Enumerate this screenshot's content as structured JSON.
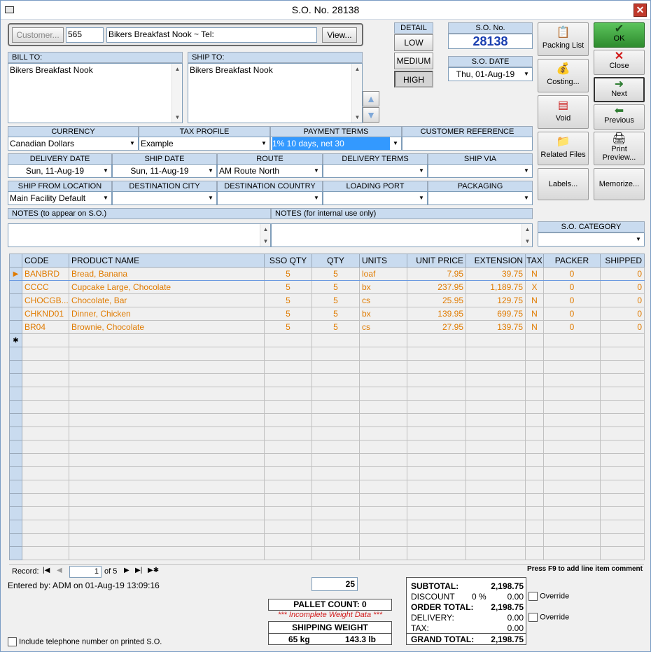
{
  "window": {
    "title": "S.O. No. 28138"
  },
  "customer": {
    "button": "Customer...",
    "id": "565",
    "name": "Bikers Breakfast Nook  ~  Tel:",
    "view_button": "View..."
  },
  "bill_to": {
    "label": "BILL TO:",
    "text": "Bikers Breakfast Nook"
  },
  "ship_to": {
    "label": "SHIP TO:",
    "text": "Bikers Breakfast Nook"
  },
  "detail": {
    "label": "DETAIL",
    "low": "LOW",
    "medium": "MEDIUM",
    "high": "HIGH",
    "selected": "HIGH"
  },
  "so_no": {
    "label": "S.O. No.",
    "value": "28138"
  },
  "so_date": {
    "label": "S.O. DATE",
    "value": "Thu, 01-Aug-19"
  },
  "buttons": {
    "packing_list": "Packing List",
    "costing": "Costing...",
    "void": "Void",
    "related_files": "Related Files",
    "labels": "Labels...",
    "ok": "OK",
    "close": "Close",
    "next": "Next",
    "previous": "Previous",
    "print_preview_1": "Print",
    "print_preview_2": "Preview...",
    "memorize": "Memorize..."
  },
  "row1": {
    "currency_label": "CURRENCY",
    "currency": "Canadian Dollars",
    "tax_label": "TAX PROFILE",
    "tax": "Example",
    "payment_label": "PAYMENT TERMS",
    "payment": "1% 10 days, net 30",
    "custref_label": "CUSTOMER REFERENCE",
    "custref": ""
  },
  "row2": {
    "delivery_date_label": "DELIVERY DATE",
    "delivery_date": "Sun, 11-Aug-19",
    "ship_date_label": "SHIP DATE",
    "ship_date": "Sun, 11-Aug-19",
    "route_label": "ROUTE",
    "route": "AM Route North",
    "delivery_terms_label": "DELIVERY TERMS",
    "delivery_terms": "",
    "ship_via_label": "SHIP VIA",
    "ship_via": ""
  },
  "row3": {
    "ship_from_label": "SHIP FROM LOCATION",
    "ship_from": "Main Facility Default",
    "dest_city_label": "DESTINATION CITY",
    "dest_city": "",
    "dest_country_label": "DESTINATION COUNTRY",
    "dest_country": "",
    "loading_port_label": "LOADING PORT",
    "loading_port": "",
    "packaging_label": "PACKAGING",
    "packaging": ""
  },
  "notes": {
    "so_label": "NOTES (to appear on S.O.)",
    "internal_label": "NOTES (for internal use only)",
    "category_label": "S.O. CATEGORY"
  },
  "grid": {
    "columns": [
      "CODE",
      "PRODUCT NAME",
      "SSO QTY",
      "QTY",
      "UNITS",
      "UNIT PRICE",
      "EXTENSION",
      "TAX",
      "PACKER",
      "SHIPPED"
    ],
    "rows": [
      [
        "BANBRD",
        "Bread, Banana",
        "5",
        "5",
        "loaf",
        "7.95",
        "39.75",
        "N",
        "0",
        "0"
      ],
      [
        "CCCC",
        "Cupcake Large, Chocolate",
        "5",
        "5",
        "bx",
        "237.95",
        "1,189.75",
        "X",
        "0",
        "0"
      ],
      [
        "CHOCGB...",
        "Chocolate, Bar",
        "5",
        "5",
        "cs",
        "25.95",
        "129.75",
        "N",
        "0",
        "0"
      ],
      [
        "CHKND01",
        "Dinner, Chicken",
        "5",
        "5",
        "bx",
        "139.95",
        "699.75",
        "N",
        "0",
        "0"
      ],
      [
        "BR04",
        "Brownie, Chocolate",
        "5",
        "5",
        "cs",
        "27.95",
        "139.75",
        "N",
        "0",
        "0"
      ]
    ]
  },
  "record_nav": {
    "label": "Record:",
    "current": "1",
    "of": "of 5",
    "hint": "Press F9 to add line item comment"
  },
  "entered_by": "Entered by: ADM on 01-Aug-19 13:09:16",
  "qty_total": "25",
  "pallet": {
    "count": "PALLET COUNT: 0",
    "warning": "*** Incomplete Weight Data ***",
    "weight_label": "SHIPPING WEIGHT",
    "kg": "65 kg",
    "lb": "143.3 lb"
  },
  "totals": {
    "subtotal_label": "SUBTOTAL:",
    "subtotal": "2,198.75",
    "discount_label": "DISCOUNT",
    "discount_pct": "0 %",
    "discount": "0.00",
    "order_total_label": "ORDER TOTAL:",
    "order_total": "2,198.75",
    "delivery_label": "DELIVERY:",
    "delivery": "0.00",
    "tax_label": "TAX:",
    "tax": "0.00",
    "grand_total_label": "GRAND TOTAL:",
    "grand_total": "2,198.75",
    "override1": "Override",
    "override2": "Override"
  },
  "include_phone": "Include telephone number on printed S.O.",
  "colors": {
    "accent": "#1a3fb0",
    "header": "#c9dbef",
    "line_text": "#e07b00",
    "ok": "#2e8b2e",
    "close_x": "#d21b1b"
  }
}
